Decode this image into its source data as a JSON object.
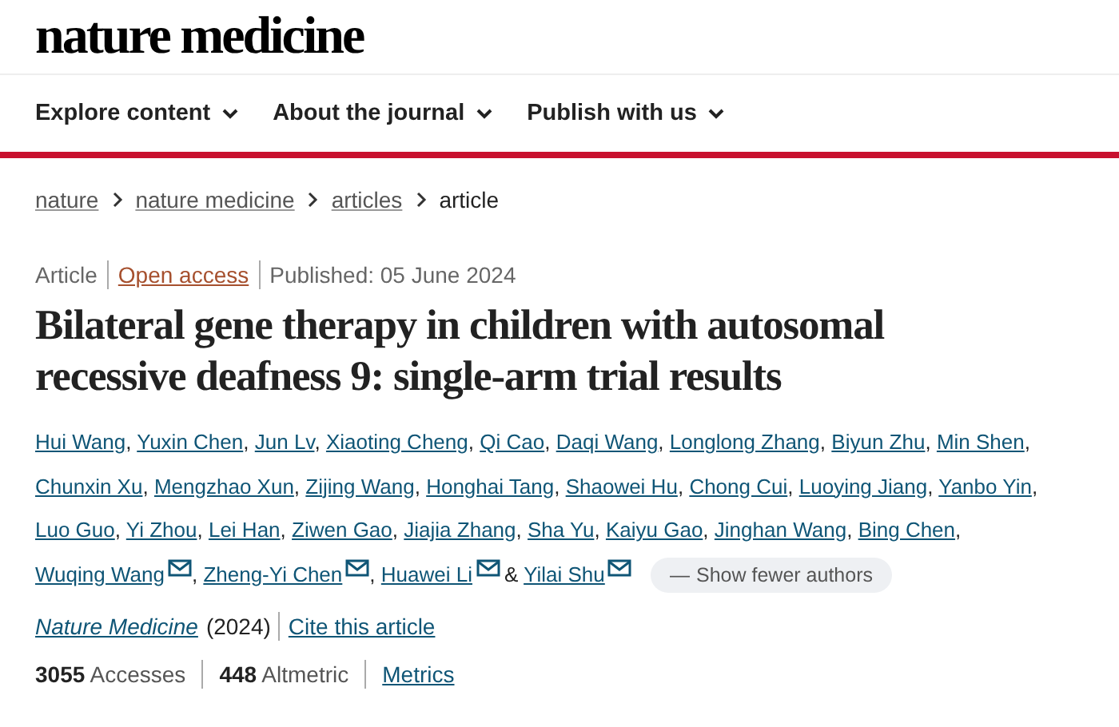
{
  "logo": "nature medicine",
  "nav": [
    {
      "label": "Explore content"
    },
    {
      "label": "About the journal"
    },
    {
      "label": "Publish with us"
    }
  ],
  "breadcrumb": [
    {
      "label": "nature",
      "link": true
    },
    {
      "label": "nature medicine",
      "link": true
    },
    {
      "label": "articles",
      "link": true
    },
    {
      "label": "article",
      "link": false
    }
  ],
  "meta": {
    "type": "Article",
    "access": "Open access",
    "published": "Published: 05 June 2024"
  },
  "title": "Bilateral gene therapy in children with autosomal recessive deafness 9: single-arm trial results",
  "authors": [
    {
      "name": "Hui Wang",
      "email": false,
      "after": ","
    },
    {
      "name": "Yuxin Chen",
      "email": false,
      "after": ","
    },
    {
      "name": "Jun Lv",
      "email": false,
      "after": ","
    },
    {
      "name": "Xiaoting Cheng",
      "email": false,
      "after": ","
    },
    {
      "name": "Qi Cao",
      "email": false,
      "after": ","
    },
    {
      "name": "Daqi Wang",
      "email": false,
      "after": ","
    },
    {
      "name": "Longlong Zhang",
      "email": false,
      "after": ","
    },
    {
      "name": "Biyun Zhu",
      "email": false,
      "after": ","
    },
    {
      "name": "Min Shen",
      "email": false,
      "after": ","
    },
    {
      "name": "Chunxin Xu",
      "email": false,
      "after": ","
    },
    {
      "name": "Mengzhao Xun",
      "email": false,
      "after": ","
    },
    {
      "name": "Zijing Wang",
      "email": false,
      "after": ","
    },
    {
      "name": "Honghai Tang",
      "email": false,
      "after": ","
    },
    {
      "name": "Shaowei Hu",
      "email": false,
      "after": ","
    },
    {
      "name": "Chong Cui",
      "email": false,
      "after": ","
    },
    {
      "name": "Luoying Jiang",
      "email": false,
      "after": ","
    },
    {
      "name": "Yanbo Yin",
      "email": false,
      "after": ","
    },
    {
      "name": "Luo Guo",
      "email": false,
      "after": ","
    },
    {
      "name": "Yi Zhou",
      "email": false,
      "after": ","
    },
    {
      "name": "Lei Han",
      "email": false,
      "after": ","
    },
    {
      "name": "Ziwen Gao",
      "email": false,
      "after": ","
    },
    {
      "name": "Jiajia Zhang",
      "email": false,
      "after": ","
    },
    {
      "name": "Sha Yu",
      "email": false,
      "after": ","
    },
    {
      "name": "Kaiyu Gao",
      "email": false,
      "after": ","
    },
    {
      "name": "Jinghan Wang",
      "email": false,
      "after": ","
    },
    {
      "name": "Bing Chen",
      "email": false,
      "after": ","
    },
    {
      "name": "Wuqing Wang",
      "email": true,
      "after": ","
    },
    {
      "name": "Zheng-Yi Chen",
      "email": true,
      "after": ","
    },
    {
      "name": "Huawei Li",
      "email": true,
      "after": "&"
    },
    {
      "name": "Yilai Shu",
      "email": true
    }
  ],
  "toggle_authors": {
    "icon": "—",
    "label": "Show fewer authors"
  },
  "citation": {
    "journal": "Nature Medicine",
    "year": "(2024)",
    "cite": "Cite this article"
  },
  "metrics": [
    "**3055** Accesses",
    "**448** Altmetric"
  ],
  "metrics_link": "Metrics"
}
